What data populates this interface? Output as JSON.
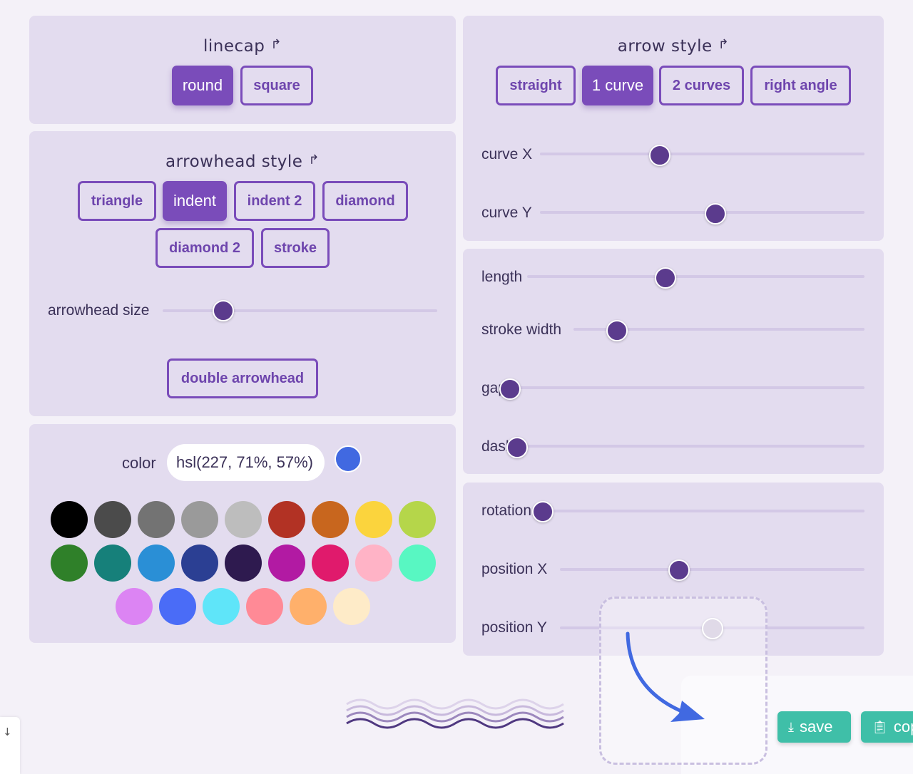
{
  "linecap": {
    "title": "linecap",
    "options": [
      {
        "label": "round",
        "active": true
      },
      {
        "label": "square",
        "active": false
      }
    ]
  },
  "arrowhead": {
    "title": "arrowhead style",
    "options": [
      {
        "label": "triangle",
        "active": false
      },
      {
        "label": "indent",
        "active": true
      },
      {
        "label": "indent 2",
        "active": false
      },
      {
        "label": "diamond",
        "active": false
      },
      {
        "label": "diamond 2",
        "active": false
      },
      {
        "label": "stroke",
        "active": false
      }
    ],
    "size_label": "arrowhead size",
    "size_value": 0.22,
    "double_label": "double arrowhead"
  },
  "color": {
    "label": "color",
    "value": "hsl(227, 71%, 57%)",
    "current_hex": "#4169e1",
    "swatches": [
      "#000000",
      "#4b4b4b",
      "#737373",
      "#9a9a9a",
      "#bdbdbd",
      "#b23224",
      "#c8661e",
      "#fbd43d",
      "#b5d64a",
      "#2f8029",
      "#16807a",
      "#2a8fd6",
      "#2b3f93",
      "#2e1a4f",
      "#b21aa3",
      "#e01a6c",
      "#ffb3c6",
      "#58f7c2",
      "#dc84f3",
      "#4a6cf7",
      "#5fe5f9",
      "#ff8a96",
      "#ffb06b",
      "#feebc8"
    ]
  },
  "arrow_style": {
    "title": "arrow style",
    "options": [
      {
        "label": "straight",
        "active": false
      },
      {
        "label": "1 curve",
        "active": true
      },
      {
        "label": "2 curves",
        "active": false
      },
      {
        "label": "right angle",
        "active": false
      }
    ],
    "curve_x_label": "curve X",
    "curve_x_value": 0.37,
    "curve_y_label": "curve Y",
    "curve_y_value": 0.54
  },
  "stroke": {
    "length_label": "length",
    "length_value": 0.41,
    "width_label": "stroke width",
    "width_value": 0.15,
    "gap_label": "gap",
    "gap_value": 0.0,
    "dash_label": "dash",
    "dash_value": 0.0
  },
  "transform": {
    "rotation_label": "rotation",
    "rotation_value": 0.0,
    "posx_label": "position X",
    "posx_value": 0.39,
    "posy_label": "position Y",
    "posy_value": 0.5
  },
  "actions": {
    "save_label": "save",
    "copy_label": "cop"
  },
  "icons": {
    "title_icon": "arrow-turn-icon",
    "save_icon": "download-icon",
    "copy_icon": "clipboard-icon",
    "scroll_icon": "arrow-down-icon"
  }
}
